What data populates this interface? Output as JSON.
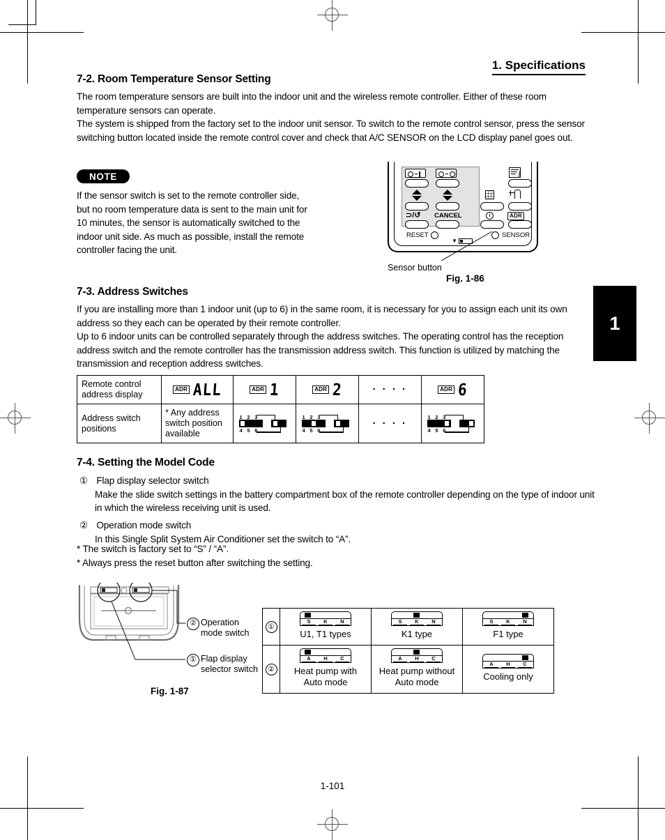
{
  "page": {
    "header_title": "1. Specifications",
    "tab_number": "1",
    "footer": "1-101"
  },
  "section_72": {
    "heading": "7-2. Room Temperature Sensor Setting",
    "paragraph1": "The room temperature sensors are built into the indoor unit and the wireless remote controller. Either of these room temperature sensors can operate.",
    "paragraph2": "The system is shipped from the factory set to the indoor unit sensor. To switch to the remote control sensor, press the sensor switching button located inside the remote control cover and check that A/C SENSOR on the LCD display panel goes out."
  },
  "note": {
    "badge": "NOTE",
    "text": "If the sensor switch is set to the remote controller side, but no room temperature data is sent to the main unit for 10 minutes, the sensor is automatically switched to the indoor unit side. As much as possible, install the remote controller facing the unit."
  },
  "fig_186": {
    "caption": "Sensor button",
    "label": "Fig. 1-86",
    "buttons": {
      "timer_on_label": "timer-on-icon",
      "timer_off_label": "timer-off-icon",
      "repeat_label": "⊃/↺",
      "cancel_label": "CANCEL",
      "flap_label": "flap-icon",
      "air_swing_label": "air-direction-icon",
      "grid_label": "grid-icon",
      "clock_label": "clock-icon",
      "adr_label": "ADR",
      "reset_label": "RESET",
      "sensor_label": "SENSOR",
      "battery_label": "▼"
    }
  },
  "section_73": {
    "heading": "7-3. Address Switches",
    "paragraph1": "If you are installing more than 1 indoor unit (up to 6) in the same room, it is necessary for you to assign each unit its own address so they each can be operated by their remote controller.",
    "paragraph2": "Up to 6 indoor units can be controlled separately through the address switches. The operating control has the reception address switch and the remote controller has the transmission address switch. This function is utilized by matching the transmission and reception address switches."
  },
  "address_table": {
    "row_labels": [
      "Remote control address display",
      "Address switch positions"
    ],
    "adr_tag": "ADR",
    "displays": [
      "ALL",
      "1",
      "2",
      "····",
      "6"
    ],
    "any_position_note": "* Any address switch position available",
    "switch_numbers_top": "1 2 3",
    "switch_numbers_bottom": "4 5 6",
    "dots": "· · · ·",
    "switch_positions": [
      {
        "display": "1",
        "knob_left_pct": 4,
        "knob_right": true
      },
      {
        "display": "2",
        "knob_left_pct": 46,
        "knob_right": true
      },
      {
        "display": "6",
        "knob_left_pct": 80,
        "knob_right": true
      }
    ]
  },
  "section_74": {
    "heading": "7-4. Setting the Model Code",
    "item1_num": "①",
    "item1_title": "Flap display selector switch",
    "item1_text": "Make the slide switch settings in the battery compartment box of the remote controller depending on the type of indoor unit in which the wireless receiving unit is used.",
    "item2_num": "②",
    "item2_title": "Operation mode switch",
    "item2_text": "In this Single Split System Air Conditioner set the switch to “A”.",
    "note1": "* The switch is factory set to “S” / “A”.",
    "note2": "* Always press the reset button after switching the setting."
  },
  "fig_187": {
    "label": "Fig. 1-87",
    "callout2_num": "②",
    "callout2_text_line1": "Operation",
    "callout2_text_line2": "mode switch",
    "callout1_num": "①",
    "callout1_text_line1": "Flap display",
    "callout1_text_line2": "selector switch"
  },
  "model_table": {
    "rows": [
      {
        "index": "①",
        "switch_labels": [
          "S",
          "K",
          "N"
        ],
        "cells": [
          {
            "label_line1": "U1, T1 types",
            "label_line2": "",
            "marker_pos": "left"
          },
          {
            "label_line1": "K1 type",
            "label_line2": "",
            "marker_pos": "center"
          },
          {
            "label_line1": "F1 type",
            "label_line2": "",
            "marker_pos": "right"
          }
        ]
      },
      {
        "index": "②",
        "switch_labels": [
          "A",
          "H",
          "C"
        ],
        "cells": [
          {
            "label_line1": "Heat pump with",
            "label_line2": "Auto mode",
            "marker_pos": "left"
          },
          {
            "label_line1": "Heat pump without",
            "label_line2": "Auto mode",
            "marker_pos": "center"
          },
          {
            "label_line1": "Cooling only",
            "label_line2": "",
            "marker_pos": "right"
          }
        ]
      }
    ]
  }
}
